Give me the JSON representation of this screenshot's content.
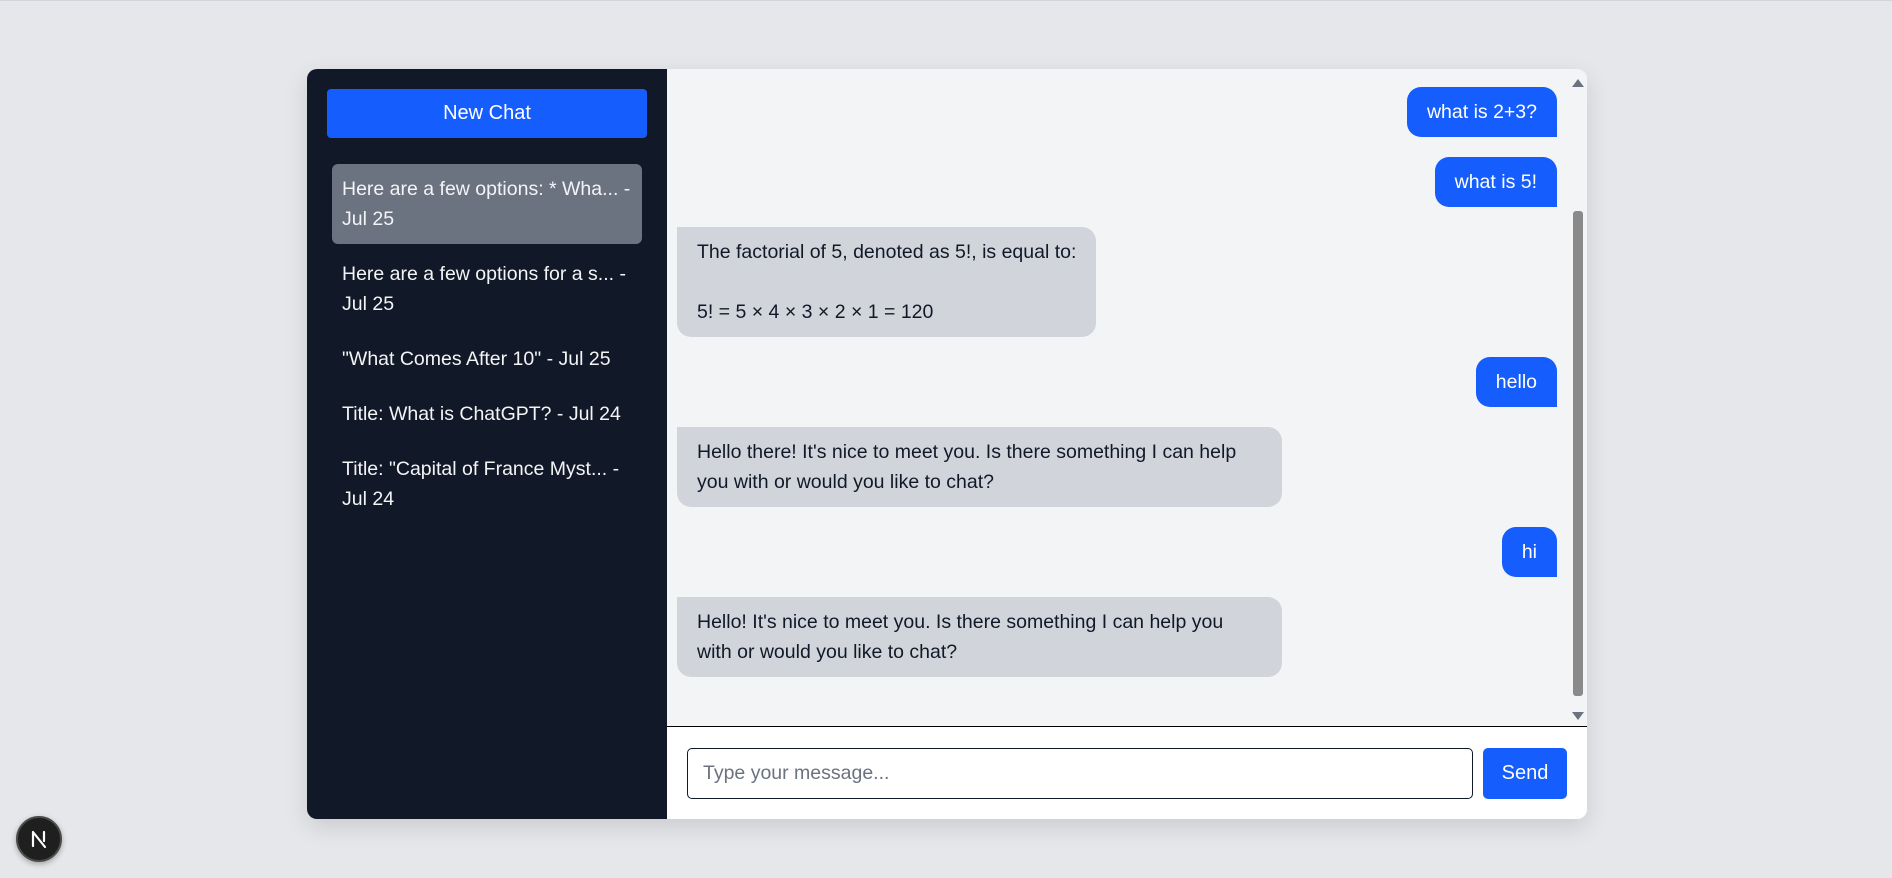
{
  "sidebar": {
    "new_chat_label": "New Chat",
    "conversations": [
      {
        "label": "Here are a few options: * Wha... - Jul 25",
        "active": true
      },
      {
        "label": "Here are a few options for a s... - Jul 25",
        "active": false
      },
      {
        "label": "\"What Comes After 10\" - Jul 25",
        "active": false
      },
      {
        "label": "Title: What is ChatGPT? - Jul 24",
        "active": false
      },
      {
        "label": "Title: \"Capital of France Myst... - Jul 24",
        "active": false
      }
    ]
  },
  "messages": [
    {
      "role": "user",
      "text": "what is 2+3?"
    },
    {
      "role": "user",
      "text": "what is 5!"
    },
    {
      "role": "assistant",
      "text": "The factorial of 5, denoted as 5!, is equal to:\n\n5! = 5 × 4 × 3 × 2 × 1 = 120"
    },
    {
      "role": "user",
      "text": "hello"
    },
    {
      "role": "assistant",
      "text": "Hello there! It's nice to meet you. Is there something I can help you with or would you like to chat?"
    },
    {
      "role": "user",
      "text": "hi"
    },
    {
      "role": "assistant",
      "text": "Hello! It's nice to meet you. Is there something I can help you with or would you like to chat?"
    }
  ],
  "composer": {
    "placeholder": "Type your message...",
    "value": "",
    "send_label": "Send"
  },
  "badge": {
    "icon": "nextjs-logo-icon"
  },
  "colors": {
    "accent": "#155dfc",
    "sidebar_bg": "#111827",
    "active_item_bg": "#6b7280",
    "assistant_bubble": "#d1d5db"
  }
}
